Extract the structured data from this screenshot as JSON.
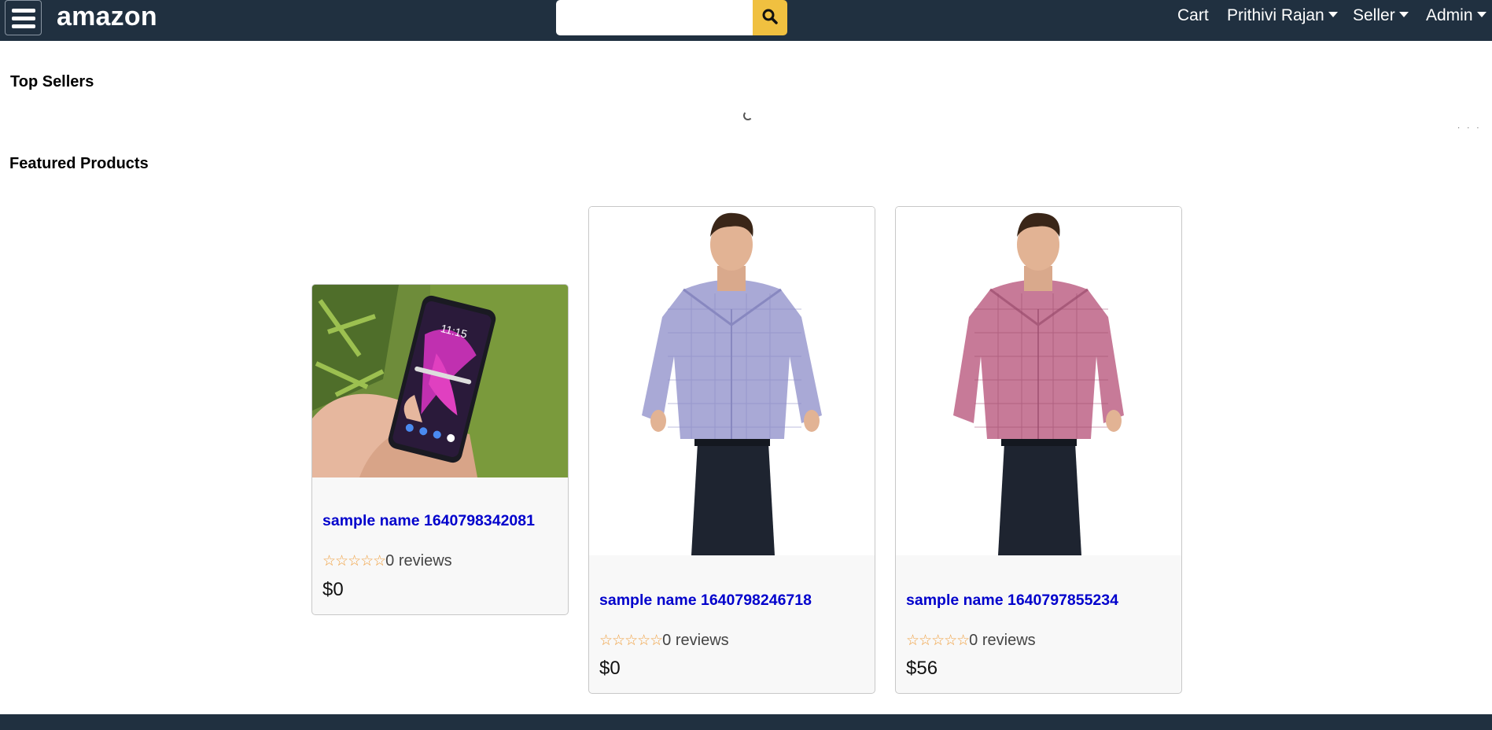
{
  "header": {
    "brand": "amazon",
    "search": {
      "value": "",
      "placeholder": ""
    },
    "nav": {
      "cart": "Cart",
      "user": "Prithivi Rajan",
      "seller": "Seller",
      "admin": "Admin"
    }
  },
  "sections": {
    "top_sellers": "Top Sellers",
    "featured": "Featured Products"
  },
  "products": [
    {
      "name": "sample name 1640798342081",
      "reviews": "0 reviews",
      "price": "$0",
      "stars": "☆☆☆☆☆",
      "rating": 0,
      "image": "phone-photo"
    },
    {
      "name": "sample name 1640798246718",
      "reviews": "0 reviews",
      "price": "$0",
      "stars": "☆☆☆☆☆",
      "rating": 0,
      "image": "blue-checked-shirt-photo"
    },
    {
      "name": "sample name 1640797855234",
      "reviews": "0 reviews",
      "price": "$56",
      "stars": "☆☆☆☆☆",
      "rating": 0,
      "image": "red-checked-shirt-photo"
    }
  ],
  "colors": {
    "header_bg": "#203040",
    "search_button": "#f0c040",
    "link": "#0000cc",
    "star": "#f0a040"
  }
}
